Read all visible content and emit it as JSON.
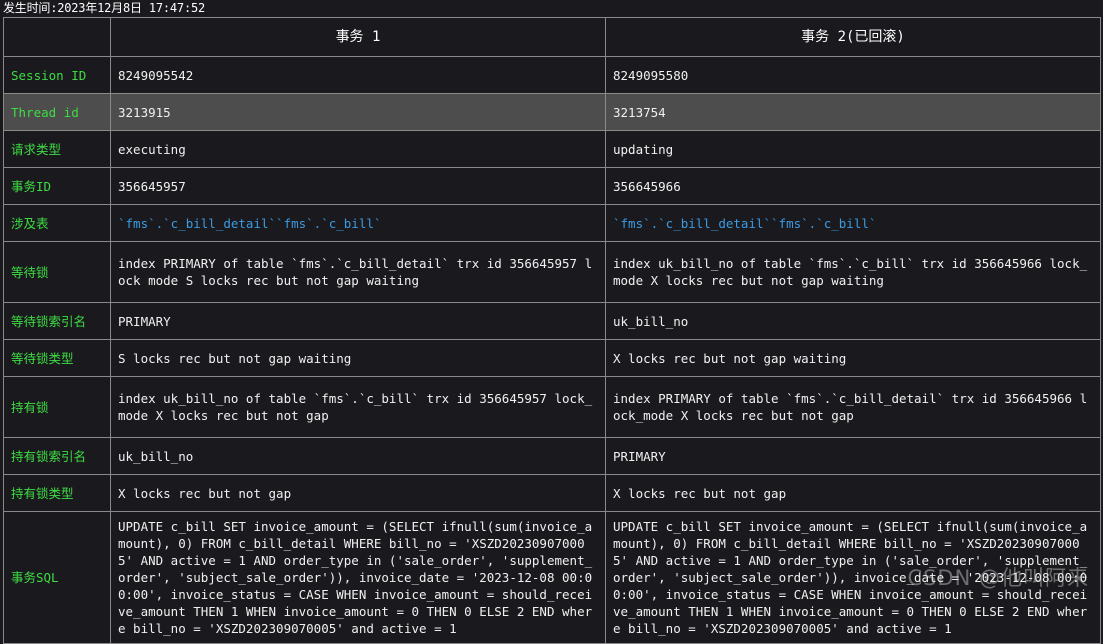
{
  "header": {
    "timestamp_label": "发生时间:2023年12月8日  17:47:52"
  },
  "table": {
    "columns": [
      {
        "key": "label",
        "header": ""
      },
      {
        "key": "trx1",
        "header": "事务 1"
      },
      {
        "key": "trx2",
        "header": "事务 2(已回滚)"
      }
    ],
    "rows": [
      {
        "label": "Session ID",
        "trx1": "8249095542",
        "trx2": "8249095580",
        "style": "plain",
        "highlight": false
      },
      {
        "label": "Thread id",
        "trx1": "3213915",
        "trx2": "3213754",
        "style": "plain",
        "highlight": true
      },
      {
        "label": "请求类型",
        "trx1": "executing",
        "trx2": "updating",
        "style": "plain",
        "highlight": false
      },
      {
        "label": "事务ID",
        "trx1": "356645957",
        "trx2": "356645966",
        "style": "plain",
        "highlight": false
      },
      {
        "label": "涉及表",
        "trx1": "`fms`.`c_bill_detail``fms`.`c_bill`",
        "trx2": "`fms`.`c_bill_detail``fms`.`c_bill`",
        "style": "cyan",
        "highlight": false
      },
      {
        "label": "等待锁",
        "trx1": "index PRIMARY of table `fms`.`c_bill_detail` trx id 356645957 lock mode S locks rec but not gap waiting",
        "trx2": "index uk_bill_no of table `fms`.`c_bill` trx id 356645966 lock_mode X locks rec but not gap waiting",
        "style": "plain",
        "highlight": false
      },
      {
        "label": "等待锁索引名",
        "trx1": "PRIMARY",
        "trx2": "uk_bill_no",
        "style": "plain",
        "highlight": false
      },
      {
        "label": "等待锁类型",
        "trx1": "S locks rec but not gap waiting",
        "trx2": "X locks rec but not gap waiting",
        "style": "plain",
        "highlight": false
      },
      {
        "label": "持有锁",
        "trx1": "index uk_bill_no of table `fms`.`c_bill` trx id 356645957 lock_mode X locks rec but not gap",
        "trx2": "index PRIMARY of table `fms`.`c_bill_detail` trx id 356645966 lock_mode X locks rec but not gap",
        "style": "plain",
        "highlight": false
      },
      {
        "label": "持有锁索引名",
        "trx1": "uk_bill_no",
        "trx2": "PRIMARY",
        "style": "plain",
        "highlight": false
      },
      {
        "label": "持有锁类型",
        "trx1": "X locks rec but not gap",
        "trx2": "X locks rec but not gap",
        "style": "plain",
        "highlight": false
      },
      {
        "label": "事务SQL",
        "trx1": "UPDATE c_bill SET invoice_amount = (SELECT ifnull(sum(invoice_amount), 0) FROM c_bill_detail WHERE bill_no = 'XSZD202309070005' AND active = 1 AND order_type in ('sale_order', 'supplement_order', 'subject_sale_order')), invoice_date = '2023-12-08 00:00:00', invoice_status = CASE WHEN invoice_amount = should_receive_amount THEN 1 WHEN invoice_amount = 0 THEN 0 ELSE 2 END where bill_no = 'XSZD202309070005' and active = 1",
        "trx2": "UPDATE c_bill SET invoice_amount = (SELECT ifnull(sum(invoice_amount), 0) FROM c_bill_detail WHERE bill_no = 'XSZD202309070005' AND active = 1 AND order_type in ('sale_order', 'supplement_order', 'subject_sale_order')), invoice_date = '2023-12-08 00:00:00', invoice_status = CASE WHEN invoice_amount = should_receive_amount THEN 1 WHEN invoice_amount = 0 THEN 0 ELSE 2 END where bill_no = 'XSZD202309070005' and active = 1",
        "style": "plain",
        "highlight": false
      }
    ]
  },
  "watermark": {
    "text": "CSDN @他叫阿来"
  },
  "colors": {
    "background": "#1a1a1e",
    "label_green": "#3ddc43",
    "value_cyan": "#3b9ae1",
    "highlight_row": "#4d4d4d",
    "border": "#8a8a8a",
    "text": "#f0f0f0"
  }
}
